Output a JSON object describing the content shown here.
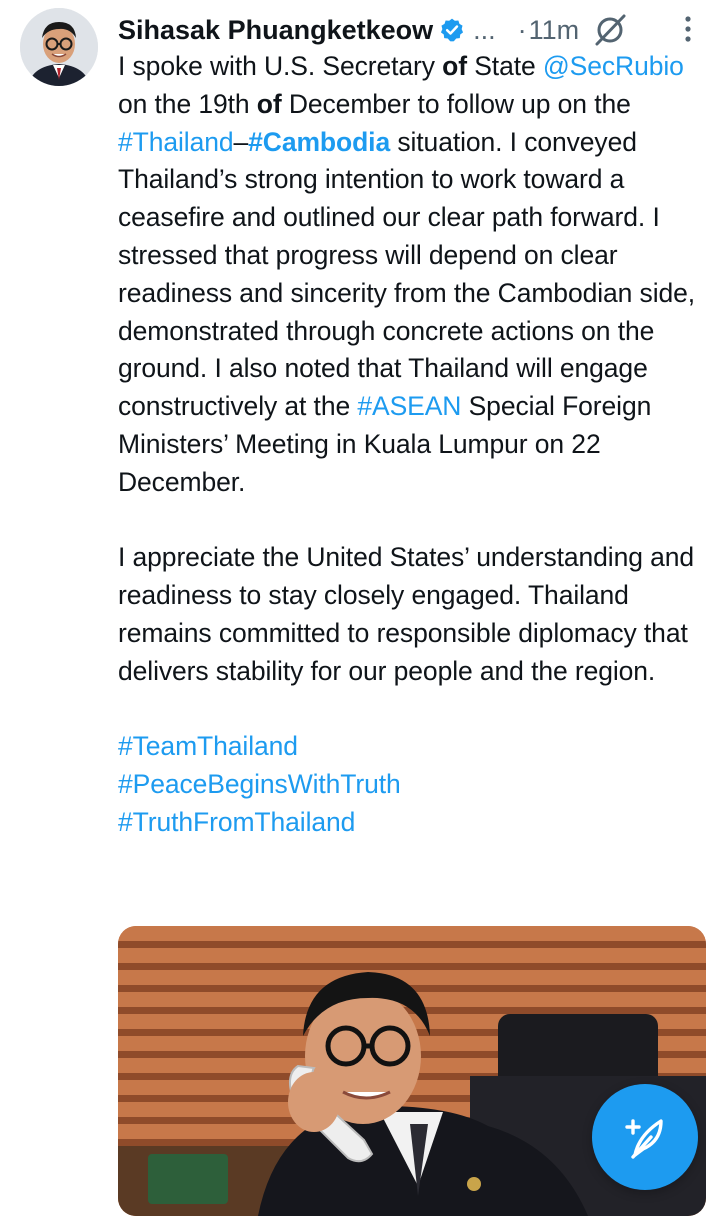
{
  "tweet": {
    "author_name": "Sihasak Phuangketkeow",
    "handle_truncated": "...",
    "separator": "·",
    "time": "11m",
    "text": {
      "p1_t1": "I spoke with U.S. Secretary ",
      "p1_b1": "of",
      "p1_t2": " State ",
      "mention": "@SecRubio",
      "p1_t3": " on the 19th ",
      "p1_b2": "of",
      "p1_t4": " December to follow up on the ",
      "hashtag_thailand": "#Thailand",
      "dash": "–",
      "hashtag_cambodia": "#Cambodia",
      "p1_t5": " situation. I conveyed Thailand’s strong intention to work toward a ceasefire and outlined our clear path forward. I stressed that progress will depend on clear readiness and sincerity from the Cambodian side, demonstrated through concrete actions on the ground. I also noted that Thailand will engage constructively at the ",
      "hashtag_asean": "#ASEAN",
      "p1_t6": " Special Foreign Ministers’ Meeting in Kuala Lumpur on 22 December.",
      "p2": "I appreciate the United States’ understanding and readiness to stay closely engaged. Thailand remains committed to responsible diplomacy that delivers stability for our people and the region.",
      "tag1": "#TeamThailand",
      "tag2": "#PeaceBeginsWithTruth",
      "tag3": "#TruthFromThailand"
    }
  },
  "colors": {
    "link": "#1d9bf0",
    "text": "#0f1419",
    "muted": "#536471",
    "fab": "#1d9bf0"
  },
  "icons": {
    "verified": "verified-badge-icon",
    "grok": "grok-icon",
    "more": "more-vertical-icon",
    "compose": "compose-post-icon"
  }
}
